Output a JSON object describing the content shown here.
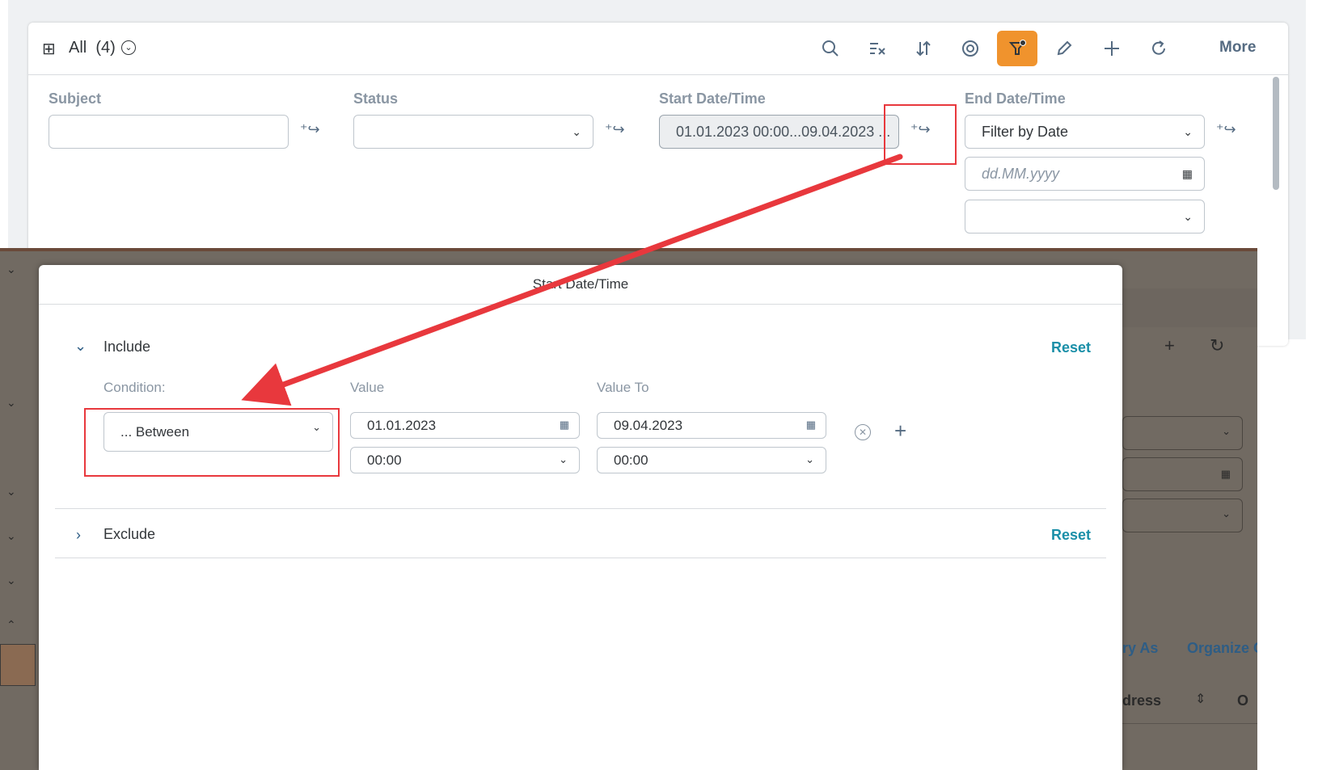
{
  "toolbar": {
    "view_icon": "table-view-icon",
    "view_title": "All  (4)",
    "more_label": "More",
    "icons": [
      "search-icon",
      "clear-filter-icon",
      "sort-icon",
      "group-icon",
      "filter-icon",
      "edit-icon",
      "add-icon",
      "refresh-icon"
    ],
    "active_color": "#f0932d"
  },
  "filters": {
    "subject": {
      "label": "Subject",
      "value": ""
    },
    "status": {
      "label": "Status",
      "value": ""
    },
    "start_datetime": {
      "label": "Start Date/Time",
      "value": "01.01.2023 00:00...09.04.2023 ..."
    },
    "end_datetime": {
      "label": "End Date/Time",
      "mode": "Filter by Date",
      "date_placeholder": "dd.MM.yyyy",
      "time_value": ""
    }
  },
  "background": {
    "links": [
      "ry As",
      "Organize C"
    ],
    "columns": [
      "dress",
      "O"
    ]
  },
  "dialog": {
    "title": "Start Date/Time",
    "include": {
      "label": "Include",
      "reset": "Reset",
      "condition_label": "Condition:",
      "value_label": "Value",
      "value_to_label": "Value To",
      "condition": "... Between",
      "value_date": "01.01.2023",
      "value_time": "00:00",
      "value_to_date": "09.04.2023",
      "value_to_time": "00:00"
    },
    "exclude": {
      "label": "Exclude",
      "reset": "Reset"
    }
  },
  "annotation_color": "#e8383d"
}
